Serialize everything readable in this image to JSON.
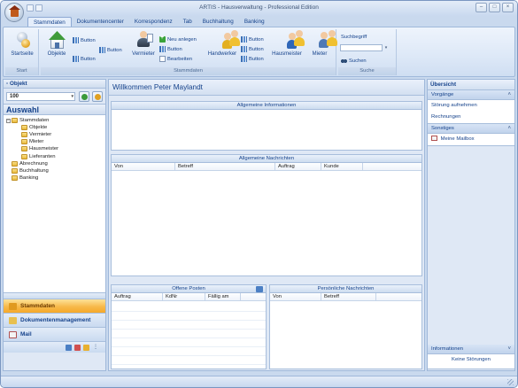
{
  "window": {
    "title": "ARTIS - Hausverwaltung - Professional Edition"
  },
  "tabs": [
    "Stammdaten",
    "Dokumentencenter",
    "Korrespondenz",
    "Tab",
    "Buchhaltung",
    "Banking"
  ],
  "ribbon": {
    "start_button": "Startseite",
    "start_group": "Start",
    "objekte_button": "Objekte",
    "button_label": "Button",
    "vermieter_button": "Vermieter",
    "neu_anlegen": "Neu anlegen",
    "bearbeiten": "Bearbeiten",
    "handwerker_button": "Handwerker",
    "hausmeister_button": "Hausmeister",
    "mieter_button": "Mieter",
    "stammdaten_group": "Stammdaten",
    "suchbegriff_label": "Suchbegriff",
    "suchen_button": "Suchen",
    "suche_group": "Suche"
  },
  "left_panel": {
    "objekt_header": "Objekt",
    "objekt_value": "100",
    "auswahl_title": "Auswahl",
    "tree": {
      "stammdaten": "Stammdaten",
      "children": [
        "Objekte",
        "Vermieter",
        "Mieter",
        "Hausmeister",
        "Lieferanten"
      ],
      "abrechnung": "Abrechnung",
      "buchhaltung": "Buchhaltung",
      "banking": "Banking"
    },
    "nav": {
      "stammdaten": "Stammdaten",
      "dokumentenmanagement": "Dokumentenmanagement",
      "mail": "Mail"
    }
  },
  "center": {
    "welcome": "Willkommen Peter Maylandt",
    "allgemeine_informationen": "Allgemeine Informationen",
    "allgemeine_nachrichten": "Allgemeine Nachrichten",
    "nachrichten_columns": [
      "Von",
      "Betreff",
      "Auftrag",
      "Kunde"
    ],
    "offene_posten": "Offene Posten",
    "posten_columns": [
      "Auftrag",
      "KdNr",
      "Fällig am"
    ],
    "persoenliche_nachrichten": "Persönliche Nachrichten",
    "persoenlich_columns": [
      "Von",
      "Betreff"
    ]
  },
  "right_panel": {
    "title": "Übersicht",
    "vorgaenge": "Vorgänge",
    "vorgaenge_items": [
      "Störung aufnehmen",
      "Rechnungen"
    ],
    "sonstiges": "Sonstiges",
    "meine_mailbox": "Meine Mailbox",
    "informationen": "Informationen",
    "keine_stoerungen": "Keine Störungen"
  },
  "colors": {
    "accent_orange": "#f7b94a",
    "frame_blue": "#c9d9ee",
    "text_blue": "#15428b"
  }
}
